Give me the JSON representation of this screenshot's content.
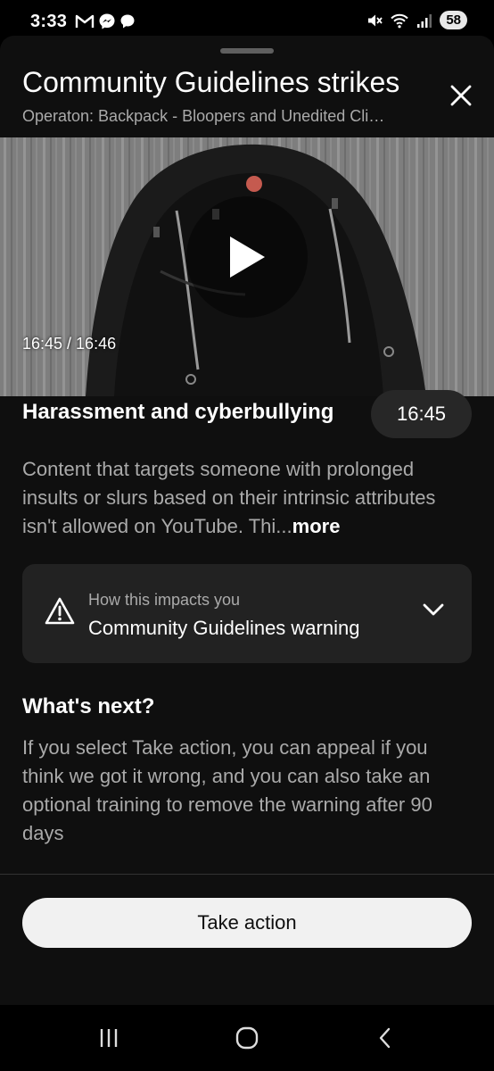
{
  "status_bar": {
    "time": "3:33",
    "battery": "58",
    "left_icons": [
      "gmail-icon",
      "messenger-icon",
      "chat-icon"
    ],
    "right_icons": [
      "mute-icon",
      "wifi-icon",
      "signal-icon",
      "battery-icon"
    ]
  },
  "sheet": {
    "title": "Community Guidelines strikes",
    "subtitle": "Operaton: Backpack - Bloopers and Unedited Cli…",
    "close_icon": "close-icon"
  },
  "video": {
    "time_label": "16:45 / 16:46",
    "progress": 0.999,
    "progress_color": "#ff0000"
  },
  "policy": {
    "title": "Harassment and cyberbullying",
    "timestamp": "16:45",
    "description": "Content that targets someone with prolonged insults or slurs based on their intrinsic attributes isn't allowed on YouTube. Thi...",
    "more_label": "more"
  },
  "impact": {
    "label": "How this impacts you",
    "value": "Community Guidelines warning",
    "icon": "warning-icon",
    "expand_icon": "chevron-down-icon"
  },
  "next": {
    "title": "What's next?",
    "description": "If you select Take action, you can appeal if you think we got it wrong, and you can also take an optional training to remove the warning after 90 days"
  },
  "action": {
    "label": "Take action"
  },
  "nav": {
    "items": [
      "recent-apps-icon",
      "home-icon",
      "back-icon"
    ]
  },
  "colors": {
    "background": "#0f0f0f",
    "card": "#222222",
    "accent": "#ff0000",
    "button": "#f1f1f1"
  }
}
